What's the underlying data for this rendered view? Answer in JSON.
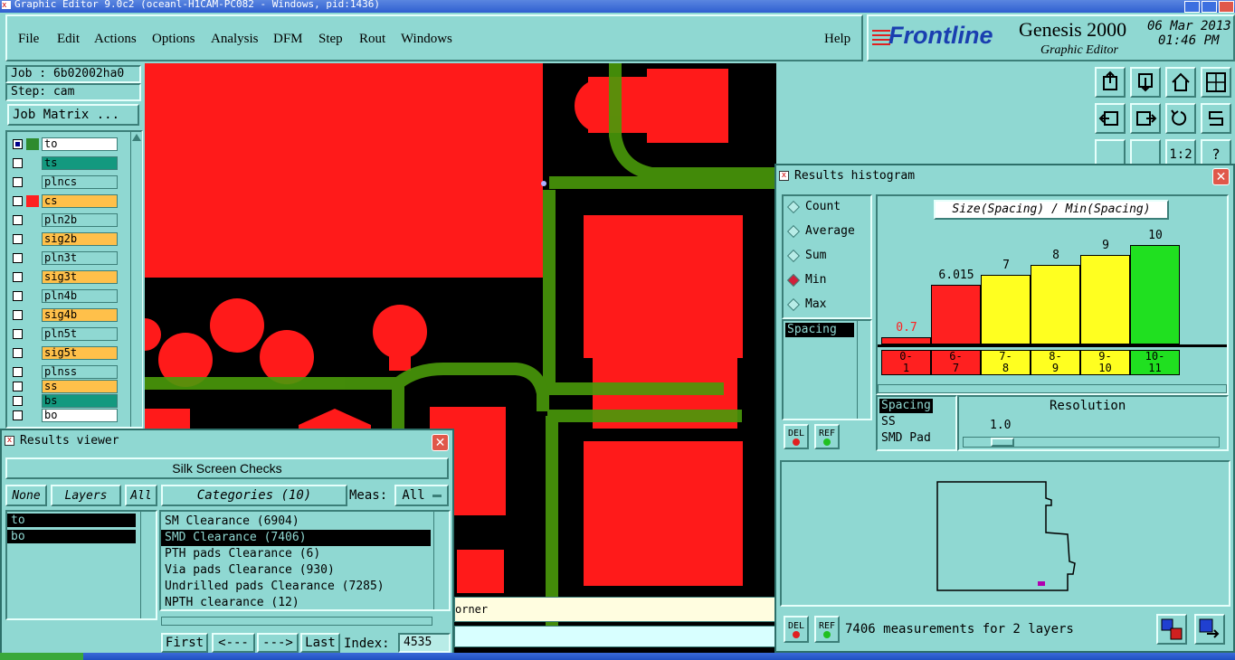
{
  "window_title": "Graphic Editor 9.0c2 (oceanl-H1CAM-PC082 - Windows, pid:1436)",
  "menu": {
    "items": [
      "File",
      "Edit",
      "Actions",
      "Options",
      "Analysis",
      "DFM",
      "Step",
      "Rout",
      "Windows"
    ],
    "help": "Help"
  },
  "brand": {
    "logo": "Frontline",
    "product": "Genesis 2000",
    "subtitle": "Graphic Editor",
    "date": "06 Mar 2013",
    "time": "01:46 PM"
  },
  "job": {
    "job_label": "Job : 6b02002ha0",
    "step_label": "Step: cam",
    "matrix_button": "Job Matrix ..."
  },
  "layers": [
    {
      "name": "to",
      "color": "#ffffff",
      "swatch": "#2e8b2e"
    },
    {
      "name": "ts",
      "color": "#13997f",
      "swatch": ""
    },
    {
      "name": "plncs",
      "color": "#8fd8d2",
      "swatch": ""
    },
    {
      "name": "cs",
      "color": "#ffc04a",
      "swatch": "#ff2020"
    },
    {
      "name": "pln2b",
      "color": "#8fd8d2",
      "swatch": ""
    },
    {
      "name": "sig2b",
      "color": "#ffc04a",
      "swatch": ""
    },
    {
      "name": "pln3t",
      "color": "#8fd8d2",
      "swatch": ""
    },
    {
      "name": "sig3t",
      "color": "#ffc04a",
      "swatch": ""
    },
    {
      "name": "pln4b",
      "color": "#8fd8d2",
      "swatch": ""
    },
    {
      "name": "sig4b",
      "color": "#ffc04a",
      "swatch": ""
    },
    {
      "name": "pln5t",
      "color": "#8fd8d2",
      "swatch": ""
    },
    {
      "name": "sig5t",
      "color": "#ffc04a",
      "swatch": ""
    },
    {
      "name": "plnss",
      "color": "#8fd8d2",
      "swatch": ""
    },
    {
      "name": "ss",
      "color": "#ffc04a",
      "swatch": ""
    },
    {
      "name": "bs",
      "color": "#13997f",
      "swatch": ""
    },
    {
      "name": "bo",
      "color": "#ffffff",
      "swatch": ""
    }
  ],
  "results_viewer": {
    "title": "Results viewer",
    "header": "Silk Screen Checks",
    "none_btn": "None",
    "layers_btn": "Layers",
    "all_btn": "All",
    "categories_btn": "Categories (10)",
    "meas_label": "Meas:",
    "meas_value": "All",
    "layer_list": [
      "to",
      "bo"
    ],
    "categories": [
      "SM Clearance (6904)",
      "SMD Clearance (7406)",
      "PTH pads Clearance (6)",
      "Via pads Clearance (930)",
      "Undrilled pads Clearance (7285)",
      "NPTH clearance (12)"
    ],
    "selected_category_index": 1,
    "first_btn": "First",
    "prev_btn": "<---",
    "next_btn": "--->",
    "last_btn": "Last",
    "index_label": "Index:",
    "index_value": "4535"
  },
  "status_bar_text": "orner",
  "histogram": {
    "title": "Results histogram",
    "modes": [
      "Count",
      "Average",
      "Sum",
      "Min",
      "Max"
    ],
    "selected_mode": "Min",
    "list_item": "Spacing",
    "del_btn": "DEL",
    "ref_btn": "REF",
    "chart_title": "Size(Spacing) / Min(Spacing)",
    "measurement_types": [
      "Spacing",
      "SS",
      "SMD Pad"
    ],
    "resolution_label": "Resolution",
    "resolution_value": "1.0",
    "status": "7406 measurements for 2 layers"
  },
  "chart_data": {
    "type": "bar",
    "title": "Size(Spacing) / Min(Spacing)",
    "categories": [
      "0-1",
      "6-7",
      "7-8",
      "8-9",
      "9-10",
      "10-11"
    ],
    "values": [
      0.7,
      6.015,
      7,
      8,
      9,
      10
    ],
    "value_labels": [
      "0.7",
      "6.015",
      "7",
      "8",
      "9",
      "10"
    ],
    "category_top": [
      "0-",
      "6-",
      "7-",
      "8-",
      "9-",
      "10-"
    ],
    "category_bottom": [
      "1",
      "7",
      "8",
      "9",
      "10",
      "11"
    ],
    "bar_colors": [
      "#ff2020",
      "#ff2020",
      "#ffff20",
      "#ffff20",
      "#ffff20",
      "#20e020"
    ],
    "label_colors": [
      "#ff2020",
      "#000000",
      "#000000",
      "#000000",
      "#000000",
      "#000000"
    ],
    "ymax": 10
  }
}
